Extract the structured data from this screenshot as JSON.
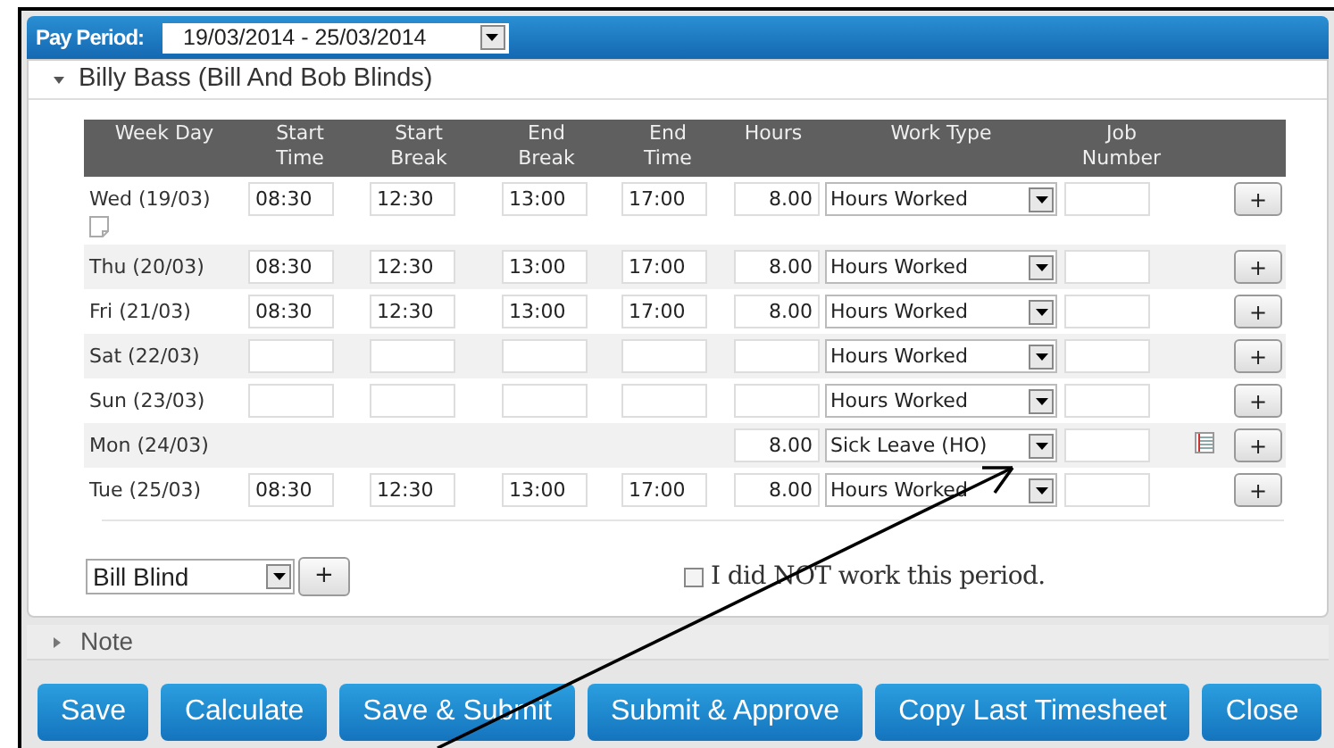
{
  "pay_period": {
    "label": "Pay Period:",
    "value": "19/03/2014 - 25/03/2014"
  },
  "employee": {
    "title": "Billy Bass (Bill And Bob Blinds)",
    "expanded": true
  },
  "table": {
    "columns": [
      "Week Day",
      "Start\nTime",
      "Start\nBreak",
      "End\nBreak",
      "End\nTime",
      "Hours",
      "Work Type",
      "Job\nNumber"
    ],
    "rows": [
      {
        "kind": "time",
        "day": "Wed (19/03)",
        "start_time": "08:30",
        "start_break": "12:30",
        "end_break": "13:00",
        "end_time": "17:00",
        "hours": "8.00",
        "work_type": "Hours Worked",
        "note_icon": true,
        "detail_icon": false
      },
      {
        "kind": "time",
        "day": "Thu (20/03)",
        "start_time": "08:30",
        "start_break": "12:30",
        "end_break": "13:00",
        "end_time": "17:00",
        "hours": "8.00",
        "work_type": "Hours Worked",
        "note_icon": false,
        "detail_icon": false
      },
      {
        "kind": "time",
        "day": "Fri (21/03)",
        "start_time": "08:30",
        "start_break": "12:30",
        "end_break": "13:00",
        "end_time": "17:00",
        "hours": "8.00",
        "work_type": "Hours Worked",
        "note_icon": false,
        "detail_icon": false
      },
      {
        "kind": "time",
        "day": "Sat (22/03)",
        "work_type": "Hours Worked",
        "note_icon": false,
        "detail_icon": false
      },
      {
        "kind": "time",
        "day": "Sun (23/03)",
        "work_type": "Hours Worked",
        "note_icon": false,
        "detail_icon": false
      },
      {
        "kind": "leave",
        "day": "Mon (24/03)",
        "hours": "8.00",
        "work_type": "Sick Leave (HO)",
        "note_icon": false,
        "detail_icon": true
      },
      {
        "kind": "time",
        "day": "Tue (25/03)",
        "start_time": "08:30",
        "start_break": "12:30",
        "end_break": "13:00",
        "end_time": "17:00",
        "hours": "8.00",
        "work_type": "Hours Worked",
        "note_icon": false,
        "detail_icon": false
      }
    ],
    "add_label": "+"
  },
  "employee_select": {
    "value": "Bill Blind",
    "add_label": "+"
  },
  "not_worked": {
    "label": "I did NOT work this period.",
    "checked": false
  },
  "note": {
    "title": "Note",
    "expanded": false
  },
  "buttons": [
    "Save",
    "Calculate",
    "Save & Submit",
    "Submit & Approve",
    "Copy Last Timesheet",
    "Close"
  ]
}
